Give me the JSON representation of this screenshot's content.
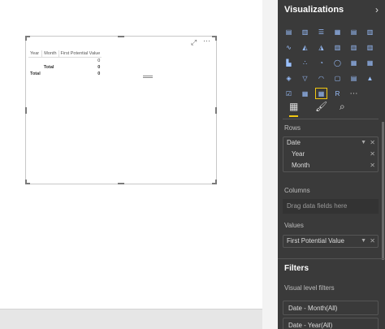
{
  "matrix": {
    "headers": [
      "Year",
      "Month",
      "First Potential Value"
    ],
    "rows": [
      {
        "year": "",
        "month": "",
        "value": "0"
      },
      {
        "year": "",
        "month": "Total",
        "value": "0"
      },
      {
        "year": "Total",
        "month": "",
        "value": "0"
      }
    ]
  },
  "visual_header": {
    "more_label": "⋯",
    "focus_icon": "focus-mode-icon"
  },
  "panel": {
    "title": "Visualizations",
    "chevron": "›",
    "viz_icons": [
      "stacked-bar-icon",
      "stacked-column-icon",
      "clustered-bar-icon",
      "clustered-column-icon",
      "100-bar-icon",
      "100-column-icon",
      "line-icon",
      "area-icon",
      "stacked-area-icon",
      "line-column-icon",
      "line-column2-icon",
      "ribbon-icon",
      "waterfall-icon",
      "scatter-icon",
      "pie-icon",
      "donut-icon",
      "treemap-icon",
      "map-icon",
      "filled-map-icon",
      "funnel-icon",
      "gauge-icon",
      "card-icon",
      "multirow-card-icon",
      "kpi-icon",
      "slicer-icon",
      "table-icon",
      "matrix-icon",
      "r-icon",
      "more-icon"
    ],
    "tabs": {
      "fields": "fields-icon",
      "format": "paint-roller-icon",
      "analytics": "analytics-icon"
    },
    "wells": {
      "rows_label": "Rows",
      "rows_field": "Date",
      "rows_sub": [
        "Year",
        "Month"
      ],
      "columns_label": "Columns",
      "columns_placeholder": "Drag data fields here",
      "values_label": "Values",
      "values_field": "First Potential Value"
    },
    "filters": {
      "title": "Filters",
      "section": "Visual level filters",
      "items": [
        "Date - Month(All)",
        "Date - Year(All)"
      ]
    }
  },
  "colors": {
    "accent": "#f2c811",
    "panel_bg": "#3a3a3a"
  }
}
